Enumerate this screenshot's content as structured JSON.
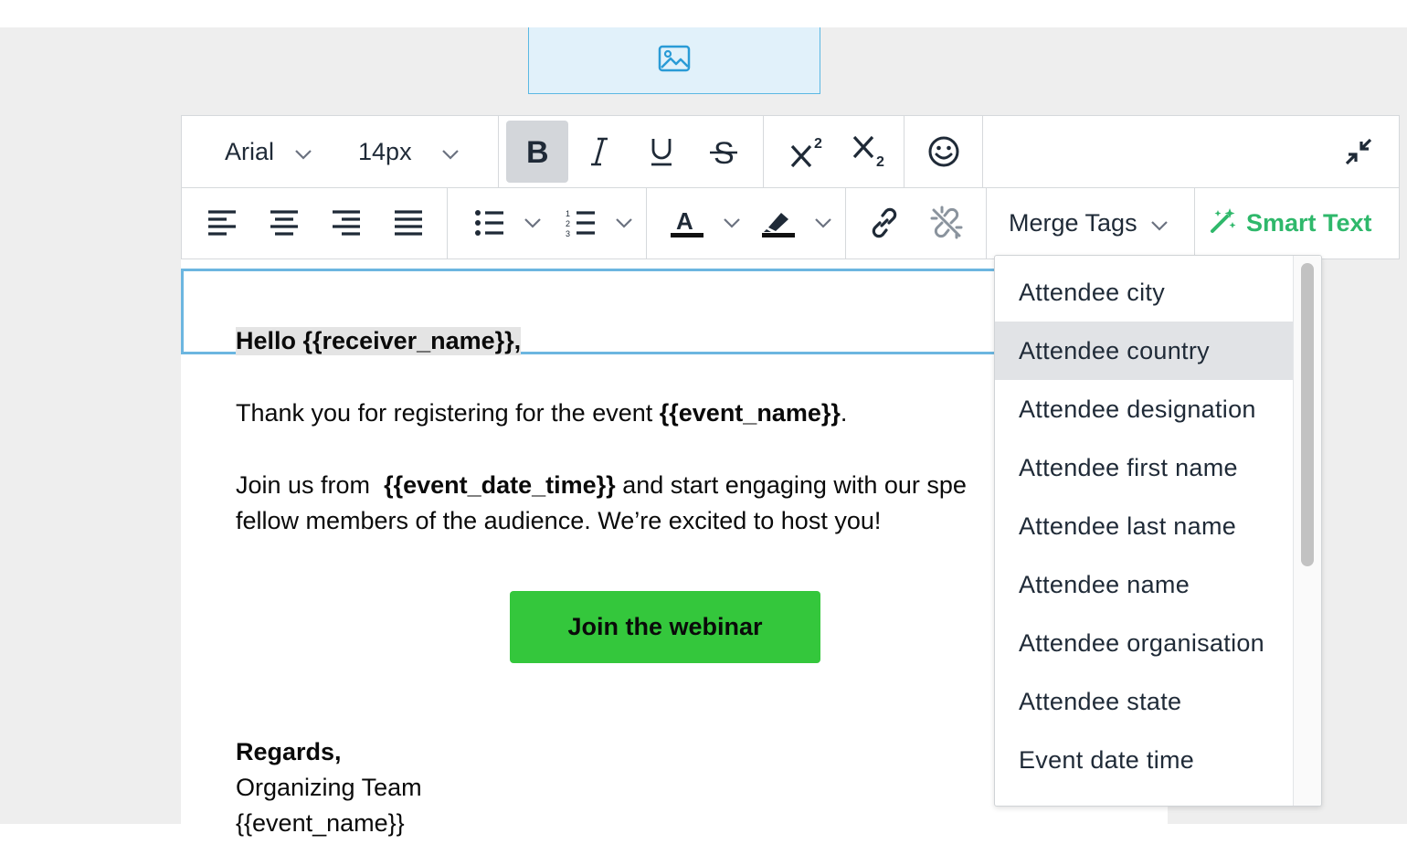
{
  "toolbar": {
    "font_family": "Arial",
    "font_size": "14px",
    "merge_tags_label": "Merge Tags",
    "smart_text_label": "Smart Text"
  },
  "email": {
    "greeting": "Hello {{receiver_name}},",
    "para1_prefix": "Thank you for registering for the event ",
    "para1_tag": "{{event_name}}",
    "para1_suffix": ".",
    "para2_prefix": "Join us from  ",
    "para2_tag": "{{event_date_time}}",
    "para2_suffix": " and start engaging with our spe",
    "para2_line2": "fellow members of the audience. We’re excited to host you!",
    "cta_label": "Join the webinar",
    "regards": "Regards,",
    "team": "Organizing Team",
    "event_tag": "{{event_name}}"
  },
  "merge_tags": {
    "items": [
      "Attendee city",
      "Attendee country",
      "Attendee designation",
      "Attendee first name",
      "Attendee last name",
      "Attendee name",
      "Attendee organisation",
      "Attendee state",
      "Event date time"
    ],
    "highlighted": "Attendee country"
  },
  "colors": {
    "accent_selection": "#6cb6e0",
    "cta_green": "#34c73c",
    "smart_text_green": "#2fb86b"
  }
}
